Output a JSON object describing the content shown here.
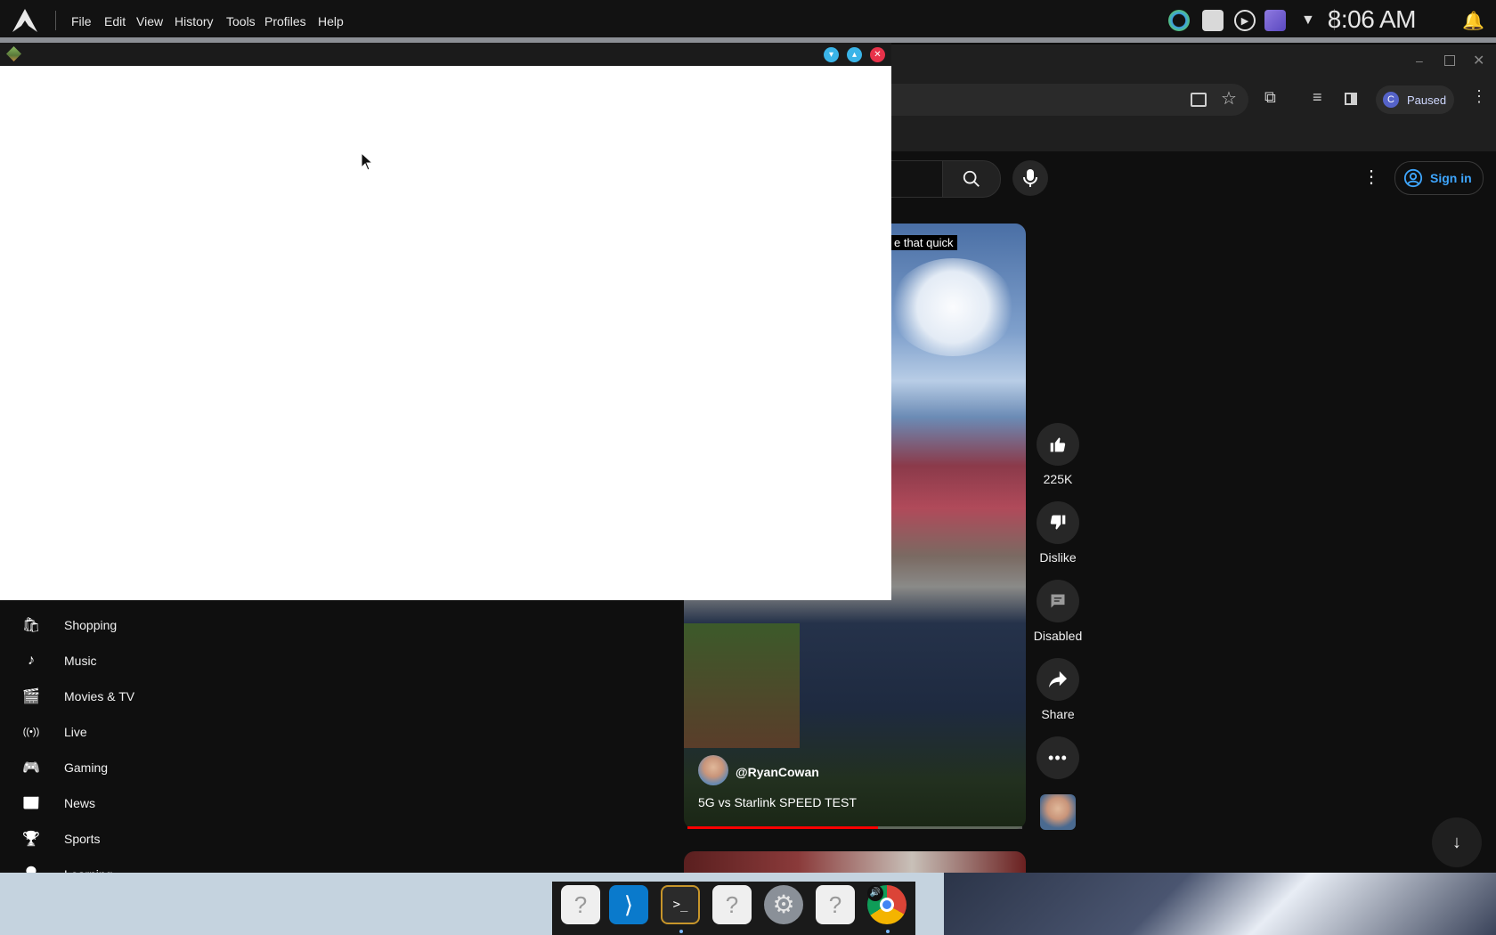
{
  "system_bar": {
    "menus": [
      "File",
      "Edit",
      "View",
      "History",
      "Tools",
      "Profiles",
      "Help"
    ],
    "clock": "8:06 AM"
  },
  "browser": {
    "profile_initial": "C",
    "profile_status": "Paused"
  },
  "youtube": {
    "sign_in_label": "Sign in",
    "caption": "e that quick",
    "actions": {
      "like_count": "225K",
      "dislike_label": "Dislike",
      "comments_label": "Disabled",
      "share_label": "Share"
    },
    "channel": "@RyanCowan",
    "video_title": "5G vs Starlink SPEED TEST",
    "progress_fraction": 0.57,
    "sidebar": [
      {
        "label": "Shopping",
        "icon": "shopping-bag-icon",
        "glyph": "🛍"
      },
      {
        "label": "Music",
        "icon": "music-note-icon",
        "glyph": "♪"
      },
      {
        "label": "Movies & TV",
        "icon": "clapperboard-icon",
        "glyph": "🎬"
      },
      {
        "label": "Live",
        "icon": "live-broadcast-icon",
        "glyph": "((•))"
      },
      {
        "label": "Gaming",
        "icon": "gamepad-icon",
        "glyph": "🎮"
      },
      {
        "label": "News",
        "icon": "newspaper-icon",
        "glyph": "📰"
      },
      {
        "label": "Sports",
        "icon": "trophy-icon",
        "glyph": "🏆"
      },
      {
        "label": "Learning",
        "icon": "lightbulb-icon",
        "glyph": "💡"
      }
    ]
  },
  "colors": {
    "accent_link": "#3ea6ff",
    "progress_red": "#ff0000",
    "window_btn_blue": "#3ab4e8",
    "window_btn_close": "#e8324a"
  }
}
